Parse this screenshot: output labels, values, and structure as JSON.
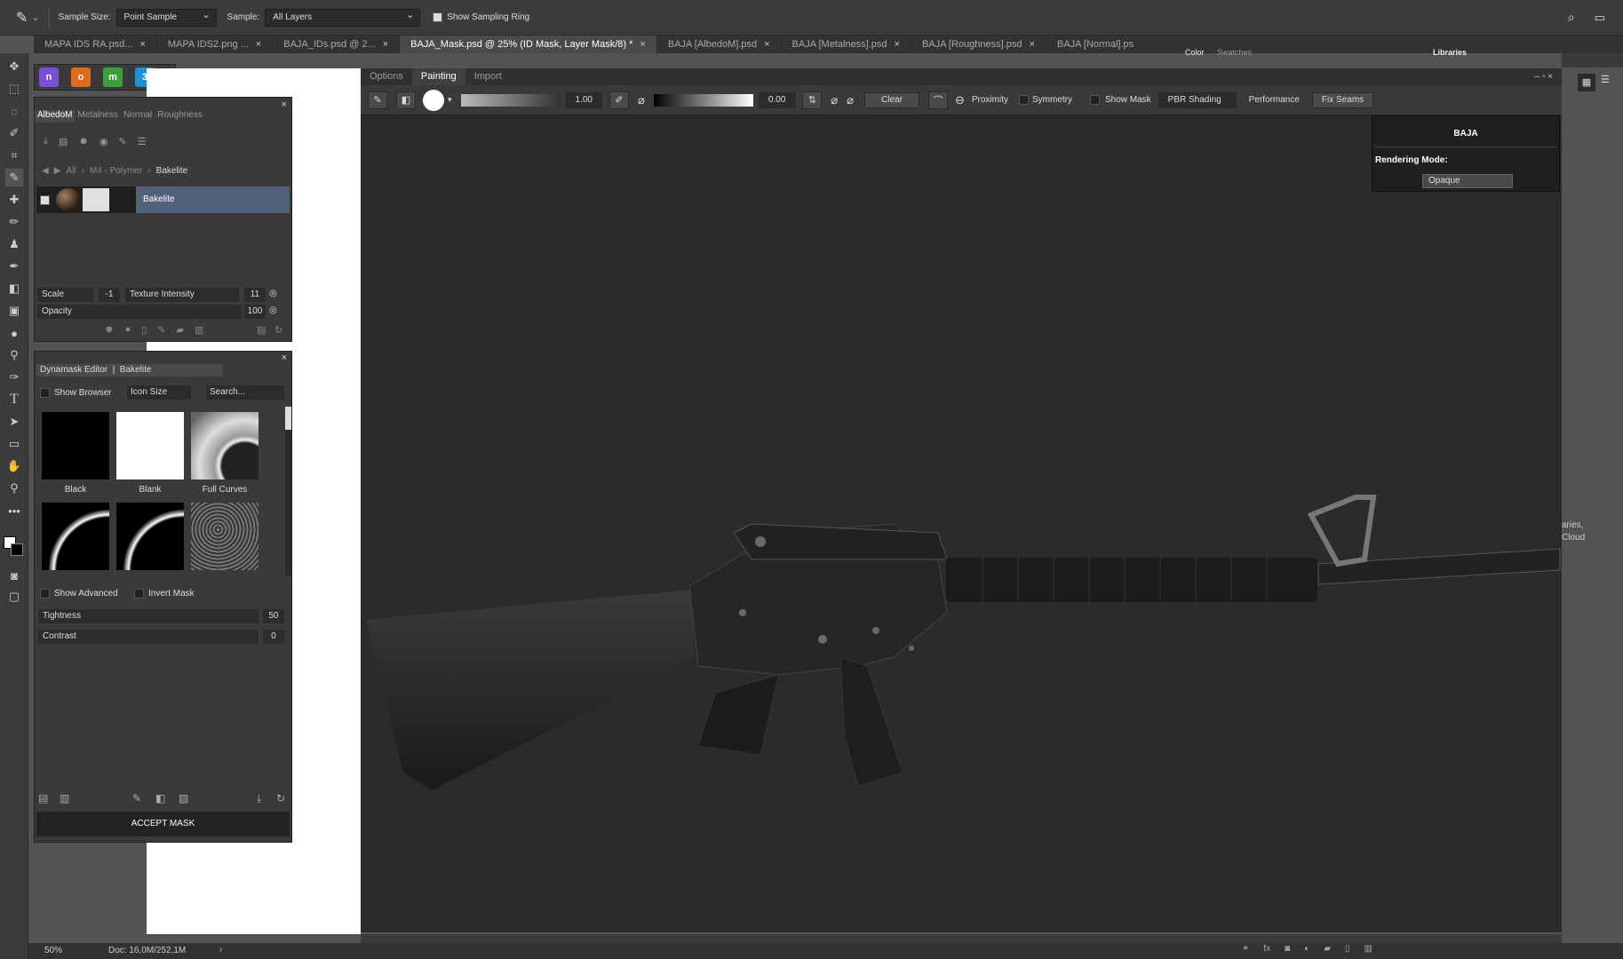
{
  "optbar": {
    "sample_size_label": "Sample Size:",
    "sample_size_value": "Point Sample",
    "sample_label": "Sample:",
    "sample_value": "All Layers",
    "show_sampling_ring": "Show Sampling Ring"
  },
  "tabs": [
    "MAPA IDS RA.psd...",
    "MAPA IDS2.png ...",
    "BAJA_IDs.psd @ 2...",
    "BAJA_Mask.psd @ 25% (ID Mask, Layer Mask/8) *",
    "BAJA [AlbedoM].psd",
    "BAJA [Metalness].psd",
    "BAJA [Roughness].psd",
    "BAJA [Normal].ps"
  ],
  "active_tab": 3,
  "right_tabs": {
    "color": "Color",
    "swatches": "Swatches",
    "libraries": "Libraries"
  },
  "plugins": [
    "n",
    "o",
    "m",
    "3"
  ],
  "material_panel": {
    "tabs": [
      "AlbedoM",
      "Metalness",
      "Normal",
      "Roughness"
    ],
    "breadcrumb": [
      "All",
      "M4 - Polymer",
      "Bakelite"
    ],
    "material_name": "Bakelite",
    "scale_label": "Scale",
    "scale_value": "-1",
    "texture_intensity_label": "Texture Intensity",
    "texture_intensity_value": "11",
    "opacity_label": "Opacity",
    "opacity_value": "100"
  },
  "dyna_panel": {
    "title": "Dynamask Editor  |  Bakelite",
    "show_browser": "Show Browser",
    "icon_size": "Icon Size",
    "search_placeholder": "Search...",
    "thumbs": [
      "Black",
      "Blank",
      "Full Curves"
    ],
    "show_advanced": "Show Advanced",
    "invert_mask": "Invert Mask",
    "tightness_label": "Tightness",
    "tightness_value": "50",
    "contrast_label": "Contrast",
    "contrast_value": "0",
    "accept": "ACCEPT MASK"
  },
  "painter": {
    "tabs": [
      "Options",
      "Painting",
      "Import"
    ],
    "active": 1,
    "brush_size": "1.00",
    "value2": "0.00",
    "clear": "Clear",
    "proximity": "Proximity",
    "symmetry": "Symmetry",
    "show_mask": "Show Mask",
    "shading": "PBR Shading",
    "performance": "Performance",
    "fix_seams": "Fix Seams"
  },
  "baja": {
    "title": "BAJA",
    "rendering_mode_label": "Rendering Mode:",
    "rendering_mode": "Opaque"
  },
  "side_text": [
    "aries,",
    "Cloud"
  ],
  "status": {
    "zoom": "50%",
    "doc": "Doc: 16,0M/252,1M"
  }
}
